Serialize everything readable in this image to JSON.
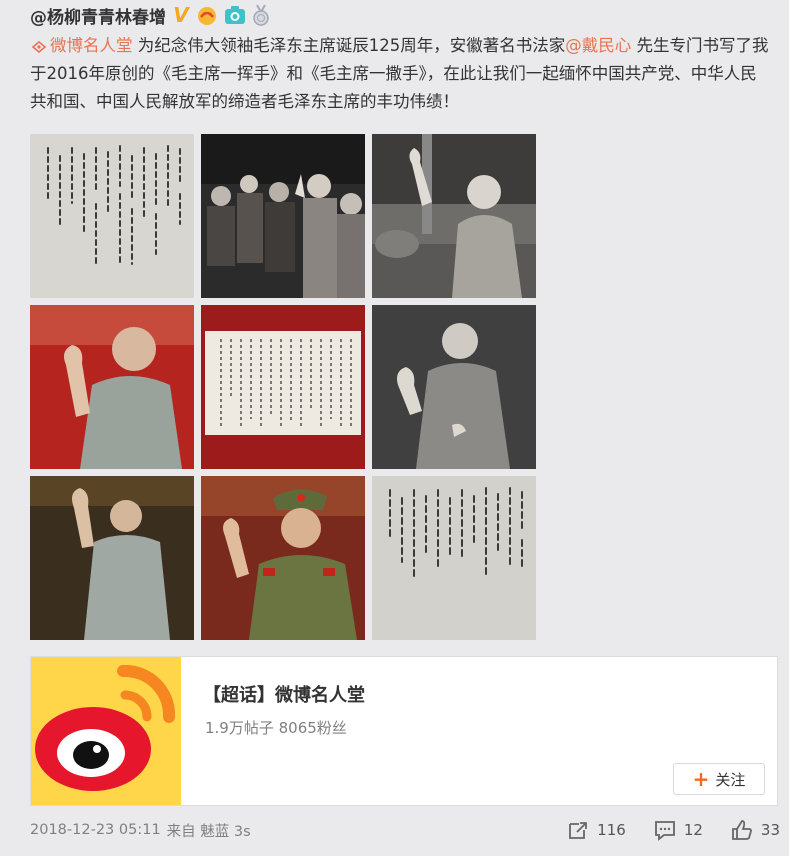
{
  "post": {
    "author": "@杨柳青青林春增",
    "content": {
      "topic_link": "微博名人堂",
      "text_1": "为纪念伟大领袖毛泽东主席诞辰125周年，安徽著名书法家",
      "mention": "@戴民心",
      "text_2": "先生专门书写了我于2016年原创的《毛主席一挥手》和《毛主席一撒手》，在此让我们一起缅怀中国共产党、中华人民共和国、中国人民解放军的缔造者毛泽东主席的丰功伟绩！"
    },
    "timestamp": "2018-12-23 05:11",
    "source": "来自 魅蓝 3s"
  },
  "images": [
    {
      "kind": "calligraphy-scroll",
      "icon": "calligraphy-image"
    },
    {
      "kind": "crowd-photo",
      "icon": "photo-image"
    },
    {
      "kind": "portrait-wave",
      "icon": "photo-image"
    },
    {
      "kind": "portrait-wave-color",
      "icon": "photo-image"
    },
    {
      "kind": "calligraphy-red-border",
      "icon": "calligraphy-image"
    },
    {
      "kind": "portrait-bw",
      "icon": "photo-image"
    },
    {
      "kind": "portrait-color-dark",
      "icon": "photo-image"
    },
    {
      "kind": "portrait-army-cap",
      "icon": "photo-image"
    },
    {
      "kind": "calligraphy-scroll-2",
      "icon": "calligraphy-image"
    }
  ],
  "card": {
    "title": "【超话】微博名人堂",
    "subtitle": "1.9万帖子 8065粉丝",
    "follow_label": "关注"
  },
  "actions": {
    "repost": "116",
    "comment": "12",
    "like": "33"
  },
  "colors": {
    "accent": "#eb7350",
    "background": "#eaeaec",
    "card_logo_bg": "#ffd54a",
    "follow_plus": "#f26a20"
  }
}
